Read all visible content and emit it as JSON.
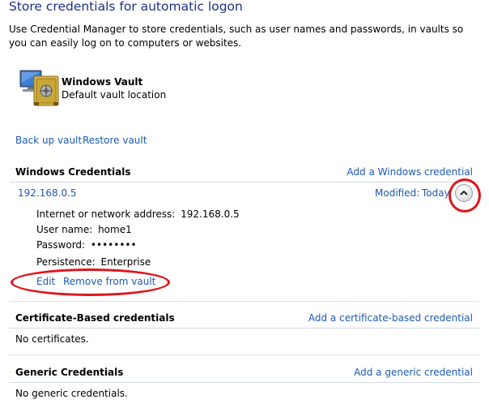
{
  "header": {
    "title": "Store credentials for automatic logon",
    "description": "Use Credential Manager to store credentials, such as user names and passwords, in vaults so you can easily log on to computers or websites."
  },
  "vault": {
    "name": "Windows Vault",
    "location": "Default vault location",
    "icon": "vault-safe-icon"
  },
  "vault_actions": {
    "backup": "Back up vault",
    "restore": "Restore vault"
  },
  "windows_credentials": {
    "title": "Windows Credentials",
    "add_link": "Add a Windows credential",
    "entry": {
      "name": "192.168.0.5",
      "modified_label": "Modified:",
      "modified_value": "Today",
      "address_label": "Internet or network address:",
      "address_value": "192.168.0.5",
      "username_label": "User name:",
      "username_value": "home1",
      "password_label": "Password:",
      "password_value": "••••••••",
      "persistence_label": "Persistence:",
      "persistence_value": "Enterprise",
      "edit_label": "Edit",
      "remove_label": "Remove from vault"
    }
  },
  "certificate_credentials": {
    "title": "Certificate-Based credentials",
    "add_link": "Add a certificate-based credential",
    "empty_text": "No certificates."
  },
  "generic_credentials": {
    "title": "Generic Credentials",
    "add_link": "Add a generic credential",
    "empty_text": "No generic credentials."
  },
  "colors": {
    "link": "#1c5ab4",
    "title": "#1e3287",
    "annotation": "#e0141b"
  }
}
